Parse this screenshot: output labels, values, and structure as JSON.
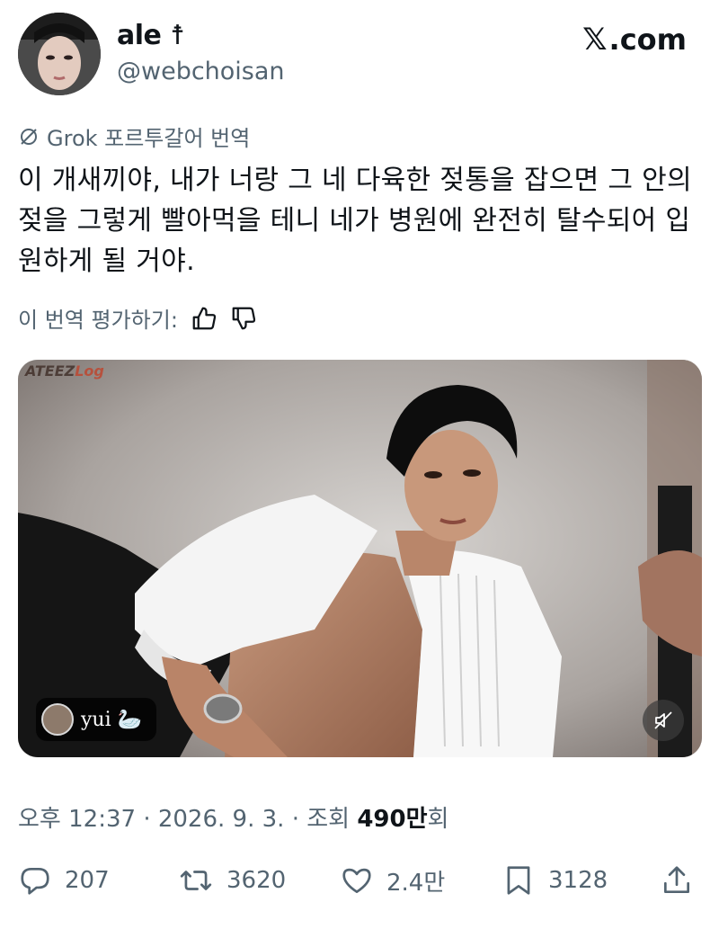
{
  "header": {
    "display_name": "ale ☨",
    "handle": "@webchoisan",
    "brand": ".com"
  },
  "translation": {
    "label": "Grok 포르투갈어 번역",
    "text": "이 개새끼야, 내가 너랑 그 네 다육한 젖통을 잡으면 그 안의 젖을 그렇게 빨아먹을 테니 네가 병원에 완전히 탈수되어 입원하게 될 거야.",
    "rate_label": "이 번역 평가하기:"
  },
  "media": {
    "watermark_prefix": "ATEEZ",
    "watermark_suffix": "Log",
    "credit_name": "yui 🦢"
  },
  "meta": {
    "time": "오후 12:37",
    "date": "2026. 9. 3.",
    "views_label": "조회",
    "views_number": "490만",
    "views_suffix": "회"
  },
  "actions": {
    "replies": "207",
    "reposts": "3620",
    "likes": "2.4만",
    "bookmarks": "3128"
  },
  "colors": {
    "text": "#0f1419",
    "secondary": "#536471"
  }
}
